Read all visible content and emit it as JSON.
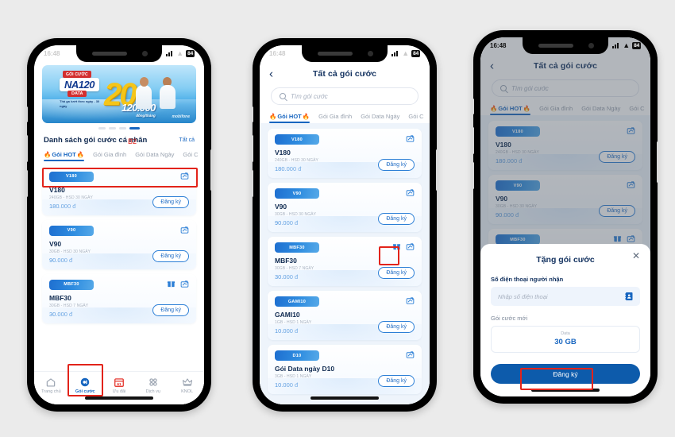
{
  "canvas": {
    "background": "#ebebeb",
    "accent": "#1866c0",
    "annotation_color": "#e2231a"
  },
  "phone1": {
    "status": {
      "time": "16:48",
      "battery": "84"
    },
    "banner": {
      "tag": "GÓI CƯỚC",
      "name": "NA120",
      "data_tag": "DATA",
      "sub": "Thả ga lướt theo ngày - 30 ngày",
      "big": "20",
      "gb": "GB",
      "price": "120.000",
      "price_sub": "đồng/tháng",
      "logo": "mobifone"
    },
    "section": {
      "title": "Danh sách gói cước cá nhân",
      "all_label": "Tất cả",
      "annotation": "B2"
    },
    "tabs": [
      {
        "label": "Gói HOT",
        "active": true,
        "fire": true
      },
      {
        "label": "Gói Gia đình",
        "active": false,
        "fire": false
      },
      {
        "label": "Gói Data Ngày",
        "active": false,
        "fire": false
      },
      {
        "label": "Gói C",
        "active": false,
        "fire": false
      }
    ],
    "plans": [
      {
        "chip": "V180",
        "name": "V180",
        "desc": "240GB - HSD 30 NGÀY",
        "price": "180.000 đ",
        "register": "Đăng ký",
        "gift_icon": false,
        "share_icon": true
      },
      {
        "chip": "V90",
        "name": "V90",
        "desc": "30GB - HSD 30 NGÀY",
        "price": "90.000 đ",
        "register": "Đăng ký",
        "gift_icon": false,
        "share_icon": true
      },
      {
        "chip": "MBF30",
        "name": "MBF30",
        "desc": "30GB - HSD 7 NGÀY",
        "price": "30.000 đ",
        "register": "Đăng ký",
        "gift_icon": true,
        "share_icon": true
      }
    ],
    "nav": [
      {
        "label": "Trang chủ",
        "icon": "home-icon",
        "active": false
      },
      {
        "label": "Gói cước",
        "icon": "package-icon",
        "active": true
      },
      {
        "label": "Ưu đãi",
        "icon": "calendar-offer-icon",
        "active": false
      },
      {
        "label": "Dịch vụ",
        "icon": "grid-icon",
        "active": false
      },
      {
        "label": "KNOL",
        "icon": "crown-icon",
        "active": false
      }
    ]
  },
  "phone2": {
    "status": {
      "time": "16:48",
      "battery": "84"
    },
    "header": {
      "title": "Tất cả gói cước",
      "back": "‹"
    },
    "search": {
      "placeholder": "Tìm gói cước",
      "icon": "search-icon"
    },
    "tabs": [
      {
        "label": "Gói HOT",
        "active": true,
        "fire": true
      },
      {
        "label": "Gói Gia đình",
        "active": false,
        "fire": false
      },
      {
        "label": "Gói Data Ngày",
        "active": false,
        "fire": false
      },
      {
        "label": "Gói C",
        "active": false,
        "fire": false
      }
    ],
    "plans": [
      {
        "chip": "V180",
        "name": "V180",
        "desc": "240GB - HSD 30 NGÀY",
        "price": "180.000 đ",
        "register": "Đăng ký",
        "gift_icon": false,
        "share_icon": true
      },
      {
        "chip": "V90",
        "name": "V90",
        "desc": "30GB - HSD 30 NGÀY",
        "price": "90.000 đ",
        "register": "Đăng ký",
        "gift_icon": false,
        "share_icon": true
      },
      {
        "chip": "MBF30",
        "name": "MBF30",
        "desc": "30GB - HSD 7 NGÀY",
        "price": "30.000 đ",
        "register": "Đăng ký",
        "gift_icon": true,
        "share_icon": true
      },
      {
        "chip": "GAMI10",
        "name": "GAMI10",
        "desc": "1GB - HSD 1 NGÀY",
        "price": "10.000 đ",
        "register": "Đăng ký",
        "gift_icon": false,
        "share_icon": true
      },
      {
        "chip": "D10",
        "name": "Gói Data ngày D10",
        "desc": "3GB - HSD 1 NGÀY",
        "price": "10.000 đ",
        "register": "Đăng ký",
        "gift_icon": false,
        "share_icon": true
      }
    ]
  },
  "phone3": {
    "status": {
      "time": "16:48",
      "battery": "84"
    },
    "header": {
      "title": "Tất cả gói cước",
      "back": "‹"
    },
    "search": {
      "placeholder": "Tìm gói cước",
      "icon": "search-icon"
    },
    "tabs": [
      {
        "label": "Gói HOT",
        "active": true,
        "fire": true
      },
      {
        "label": "Gói Gia đình",
        "active": false,
        "fire": false
      },
      {
        "label": "Gói Data Ngày",
        "active": false,
        "fire": false
      },
      {
        "label": "Gói C",
        "active": false,
        "fire": false
      }
    ],
    "plans": [
      {
        "chip": "V180",
        "name": "V180",
        "desc": "240GB - HSD 30 NGÀY",
        "price": "180.000 đ",
        "register": "Đăng ký",
        "gift_icon": false,
        "share_icon": true
      },
      {
        "chip": "V90",
        "name": "V90",
        "desc": "30GB - HSD 30 NGÀY",
        "price": "90.000 đ",
        "register": "Đăng ký",
        "gift_icon": false,
        "share_icon": true
      },
      {
        "chip": "MBF30",
        "name": "MBF30",
        "desc": "30GB - HSD 7 NGÀY",
        "price": "30.000 đ",
        "register": "Đăng ký",
        "gift_icon": true,
        "share_icon": true
      }
    ],
    "modal": {
      "title": "Tặng gói cước",
      "close": "✕",
      "phone_label": "Số điện thoại người nhận",
      "phone_placeholder": "Nhập số điện thoại",
      "phone_value": "",
      "contact_icon": "contact-book-icon",
      "package_label": "Gói cước mới",
      "package_key": "Data",
      "package_value": "30 GB",
      "submit": "Đăng ký"
    }
  }
}
